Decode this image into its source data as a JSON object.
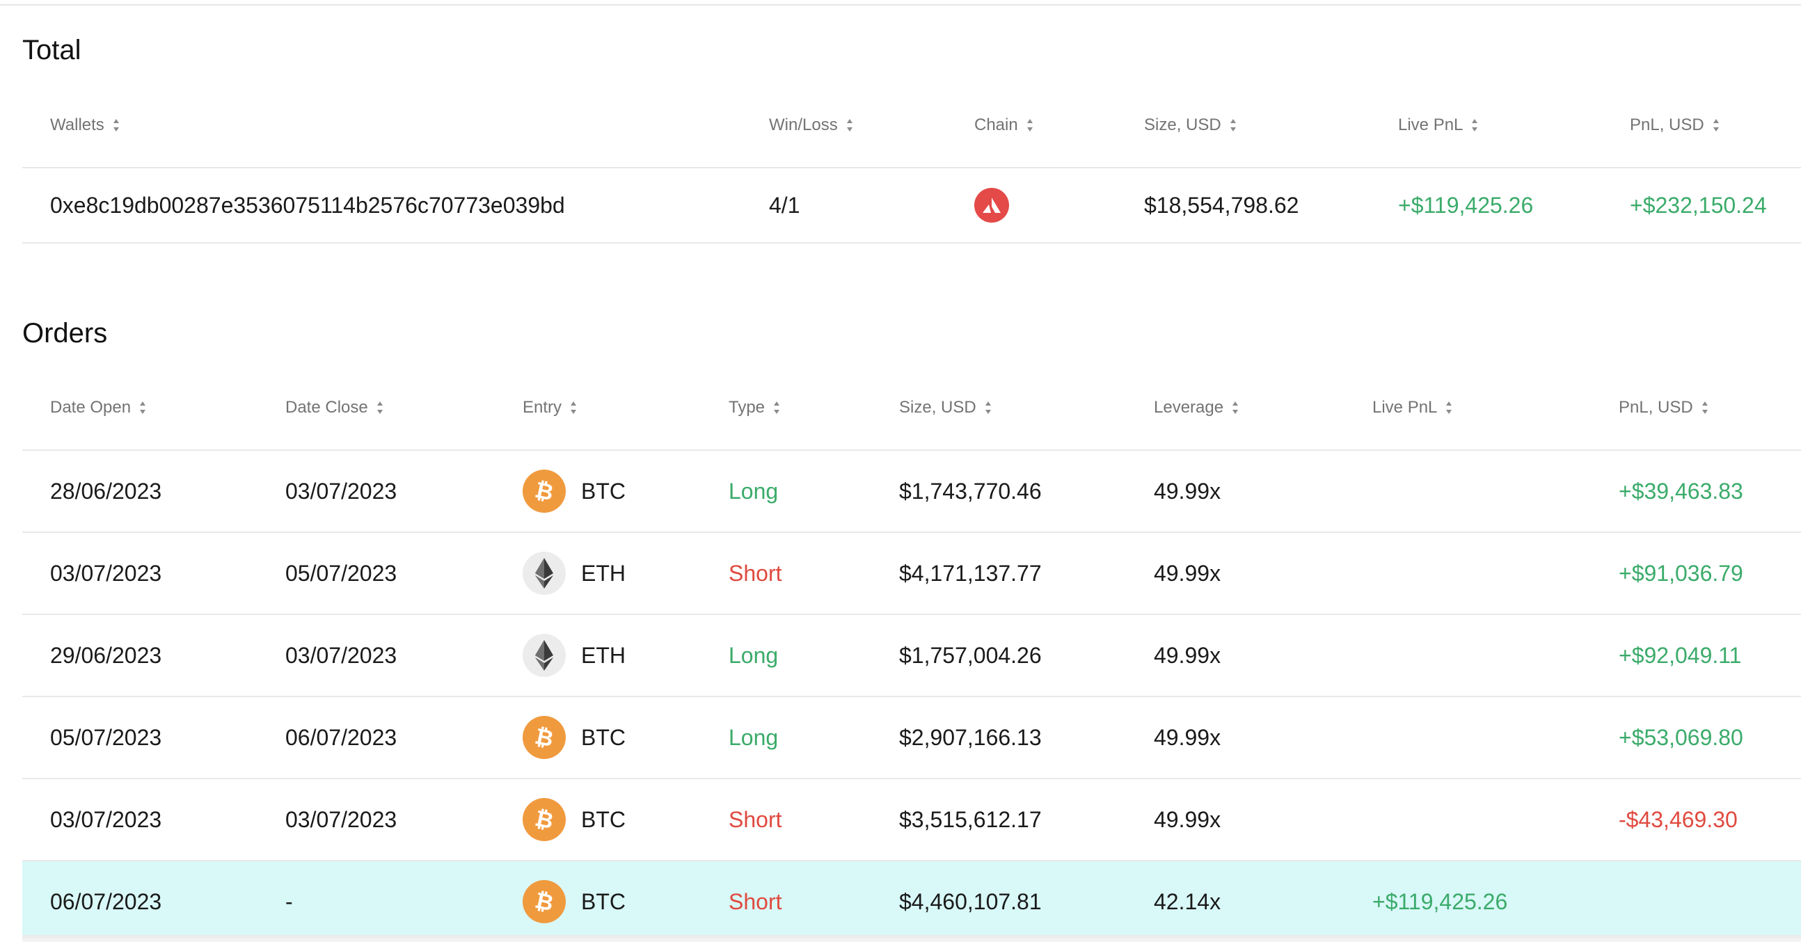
{
  "total": {
    "title": "Total",
    "headers": {
      "wallets": "Wallets",
      "winloss": "Win/Loss",
      "chain": "Chain",
      "size": "Size, USD",
      "live_pnl": "Live PnL",
      "pnl": "PnL, USD"
    },
    "row": {
      "wallet": "0xe8c19db00287e3536075114b2576c70773e039bd",
      "winloss": "4/1",
      "chain_icon": "avalanche-icon",
      "size": "$18,554,798.62",
      "live_pnl": "+$119,425.26",
      "pnl": "+$232,150.24"
    }
  },
  "orders": {
    "title": "Orders",
    "headers": {
      "date_open": "Date Open",
      "date_close": "Date Close",
      "entry": "Entry",
      "type": "Type",
      "size": "Size, USD",
      "leverage": "Leverage",
      "live_pnl": "Live PnL",
      "pnl": "PnL, USD"
    },
    "rows": [
      {
        "date_open": "28/06/2023",
        "date_close": "03/07/2023",
        "coin": "BTC",
        "coin_icon": "bitcoin-icon",
        "type": "Long",
        "size": "$1,743,770.46",
        "leverage": "49.99x",
        "live_pnl": "",
        "pnl": "+$39,463.83"
      },
      {
        "date_open": "03/07/2023",
        "date_close": "05/07/2023",
        "coin": "ETH",
        "coin_icon": "ethereum-icon",
        "type": "Short",
        "size": "$4,171,137.77",
        "leverage": "49.99x",
        "live_pnl": "",
        "pnl": "+$91,036.79"
      },
      {
        "date_open": "29/06/2023",
        "date_close": "03/07/2023",
        "coin": "ETH",
        "coin_icon": "ethereum-icon",
        "type": "Long",
        "size": "$1,757,004.26",
        "leverage": "49.99x",
        "live_pnl": "",
        "pnl": "+$92,049.11"
      },
      {
        "date_open": "05/07/2023",
        "date_close": "06/07/2023",
        "coin": "BTC",
        "coin_icon": "bitcoin-icon",
        "type": "Long",
        "size": "$2,907,166.13",
        "leverage": "49.99x",
        "live_pnl": "",
        "pnl": "+$53,069.80"
      },
      {
        "date_open": "03/07/2023",
        "date_close": "03/07/2023",
        "coin": "BTC",
        "coin_icon": "bitcoin-icon",
        "type": "Short",
        "size": "$3,515,612.17",
        "leverage": "49.99x",
        "live_pnl": "",
        "pnl": "-$43,469.30"
      },
      {
        "date_open": "06/07/2023",
        "date_close": "-",
        "coin": "BTC",
        "coin_icon": "bitcoin-icon",
        "type": "Short",
        "size": "$4,460,107.81",
        "leverage": "42.14x",
        "live_pnl": "+$119,425.26",
        "pnl": ""
      }
    ]
  },
  "colors": {
    "positive": "#3bab6a",
    "negative": "#e04a3f",
    "highlight_row": "#d9f8f8",
    "btc": "#f09a3e",
    "avalanche": "#e44a47"
  }
}
